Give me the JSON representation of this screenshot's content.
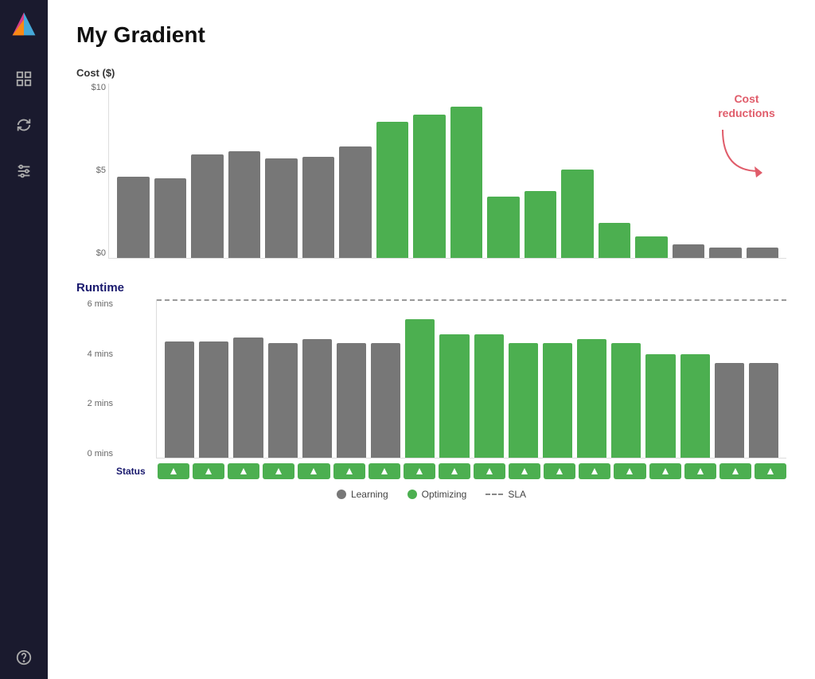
{
  "sidebar": {
    "logo_alt": "Gradient Logo",
    "items": [
      {
        "name": "dashboard",
        "icon": "grid"
      },
      {
        "name": "sync",
        "icon": "refresh"
      },
      {
        "name": "settings",
        "icon": "sliders"
      },
      {
        "name": "help",
        "icon": "question"
      }
    ]
  },
  "page": {
    "title": "My Gradient"
  },
  "cost_chart": {
    "label": "Cost ($)",
    "y_axis": [
      "$10",
      "$5",
      "$0"
    ],
    "annotation": "Cost\nreductions",
    "bars": [
      {
        "type": "gray",
        "height_pct": 49
      },
      {
        "type": "gray",
        "height_pct": 48
      },
      {
        "type": "gray",
        "height_pct": 62
      },
      {
        "type": "gray",
        "height_pct": 64
      },
      {
        "type": "gray",
        "height_pct": 60
      },
      {
        "type": "gray",
        "height_pct": 61
      },
      {
        "type": "gray",
        "height_pct": 67
      },
      {
        "type": "green",
        "height_pct": 82
      },
      {
        "type": "green",
        "height_pct": 86
      },
      {
        "type": "green",
        "height_pct": 91
      },
      {
        "type": "green",
        "height_pct": 37
      },
      {
        "type": "green",
        "height_pct": 40
      },
      {
        "type": "green",
        "height_pct": 53
      },
      {
        "type": "green",
        "height_pct": 21
      },
      {
        "type": "green",
        "height_pct": 13
      },
      {
        "type": "gray",
        "height_pct": 8
      },
      {
        "type": "gray",
        "height_pct": 6
      },
      {
        "type": "gray",
        "height_pct": 6
      }
    ]
  },
  "runtime_chart": {
    "title": "Runtime",
    "y_axis": [
      "6 mins",
      "4 mins",
      "2 mins",
      "0 mins"
    ],
    "sla_label": "SLA",
    "sla_pct": 5,
    "bars": [
      {
        "type": "gray",
        "height_pct": 77
      },
      {
        "type": "gray",
        "height_pct": 77
      },
      {
        "type": "gray",
        "height_pct": 80
      },
      {
        "type": "gray",
        "height_pct": 76
      },
      {
        "type": "gray",
        "height_pct": 79
      },
      {
        "type": "gray",
        "height_pct": 76
      },
      {
        "type": "gray",
        "height_pct": 76
      },
      {
        "type": "green",
        "height_pct": 92
      },
      {
        "type": "green",
        "height_pct": 82
      },
      {
        "type": "green",
        "height_pct": 82
      },
      {
        "type": "green",
        "height_pct": 76
      },
      {
        "type": "green",
        "height_pct": 76
      },
      {
        "type": "green",
        "height_pct": 79
      },
      {
        "type": "green",
        "height_pct": 76
      },
      {
        "type": "green",
        "height_pct": 69
      },
      {
        "type": "green",
        "height_pct": 69
      },
      {
        "type": "gray",
        "height_pct": 63
      },
      {
        "type": "gray",
        "height_pct": 63
      }
    ],
    "status": [
      "green",
      "green",
      "green",
      "green",
      "green",
      "green",
      "green",
      "green",
      "green",
      "green",
      "green",
      "green",
      "green",
      "green",
      "green",
      "green",
      "green",
      "green"
    ]
  },
  "legend": {
    "learning_label": "Learning",
    "optimizing_label": "Optimizing",
    "sla_label": "SLA",
    "learning_color": "#777",
    "optimizing_color": "#4caf50"
  },
  "status_label": "Status"
}
